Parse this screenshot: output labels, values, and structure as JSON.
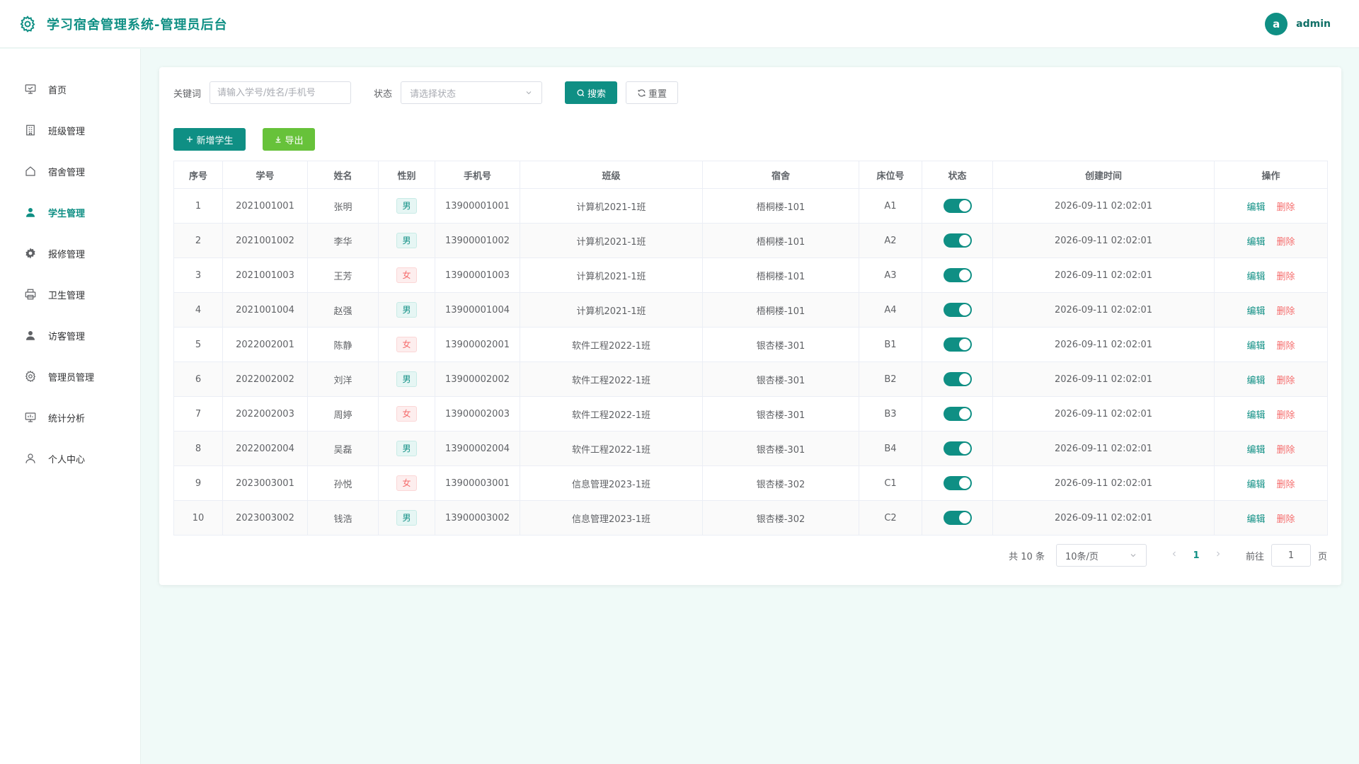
{
  "app": {
    "title": "学习宿舍管理系统-管理员后台"
  },
  "user": {
    "avatar_letter": "a",
    "name": "admin"
  },
  "sidebar": {
    "items": [
      {
        "label": "首页",
        "icon": "home-board-icon"
      },
      {
        "label": "班级管理",
        "icon": "building-icon"
      },
      {
        "label": "宿舍管理",
        "icon": "house-icon"
      },
      {
        "label": "学生管理",
        "icon": "user-icon",
        "active": true
      },
      {
        "label": "报修管理",
        "icon": "gear-icon"
      },
      {
        "label": "卫生管理",
        "icon": "printer-icon"
      },
      {
        "label": "访客管理",
        "icon": "user-icon"
      },
      {
        "label": "管理员管理",
        "icon": "gear-outline-icon"
      },
      {
        "label": "统计分析",
        "icon": "board-icon"
      },
      {
        "label": "个人中心",
        "icon": "user-outline-icon"
      }
    ]
  },
  "filters": {
    "keyword_label": "关键词",
    "keyword_placeholder": "请输入学号/姓名/手机号",
    "status_label": "状态",
    "status_placeholder": "请选择状态",
    "search_label": "搜索",
    "reset_label": "重置"
  },
  "toolbar": {
    "add_label": "新增学生",
    "export_label": "导出"
  },
  "table": {
    "columns": [
      "序号",
      "学号",
      "姓名",
      "性别",
      "手机号",
      "班级",
      "宿舍",
      "床位号",
      "状态",
      "创建时间",
      "操作"
    ],
    "edit_label": "编辑",
    "delete_label": "删除",
    "rows": [
      {
        "no": "1",
        "sid": "2021001001",
        "name": "张明",
        "gender": "男",
        "phone": "13900001001",
        "class": "计算机2021-1班",
        "dorm": "梧桐楼-101",
        "bed": "A1",
        "enabled": true,
        "created": "2026-09-11 02:02:01"
      },
      {
        "no": "2",
        "sid": "2021001002",
        "name": "李华",
        "gender": "男",
        "phone": "13900001002",
        "class": "计算机2021-1班",
        "dorm": "梧桐楼-101",
        "bed": "A2",
        "enabled": true,
        "created": "2026-09-11 02:02:01"
      },
      {
        "no": "3",
        "sid": "2021001003",
        "name": "王芳",
        "gender": "女",
        "phone": "13900001003",
        "class": "计算机2021-1班",
        "dorm": "梧桐楼-101",
        "bed": "A3",
        "enabled": true,
        "created": "2026-09-11 02:02:01"
      },
      {
        "no": "4",
        "sid": "2021001004",
        "name": "赵强",
        "gender": "男",
        "phone": "13900001004",
        "class": "计算机2021-1班",
        "dorm": "梧桐楼-101",
        "bed": "A4",
        "enabled": true,
        "created": "2026-09-11 02:02:01"
      },
      {
        "no": "5",
        "sid": "2022002001",
        "name": "陈静",
        "gender": "女",
        "phone": "13900002001",
        "class": "软件工程2022-1班",
        "dorm": "银杏楼-301",
        "bed": "B1",
        "enabled": true,
        "created": "2026-09-11 02:02:01"
      },
      {
        "no": "6",
        "sid": "2022002002",
        "name": "刘洋",
        "gender": "男",
        "phone": "13900002002",
        "class": "软件工程2022-1班",
        "dorm": "银杏楼-301",
        "bed": "B2",
        "enabled": true,
        "created": "2026-09-11 02:02:01"
      },
      {
        "no": "7",
        "sid": "2022002003",
        "name": "周婷",
        "gender": "女",
        "phone": "13900002003",
        "class": "软件工程2022-1班",
        "dorm": "银杏楼-301",
        "bed": "B3",
        "enabled": true,
        "created": "2026-09-11 02:02:01"
      },
      {
        "no": "8",
        "sid": "2022002004",
        "name": "吴磊",
        "gender": "男",
        "phone": "13900002004",
        "class": "软件工程2022-1班",
        "dorm": "银杏楼-301",
        "bed": "B4",
        "enabled": true,
        "created": "2026-09-11 02:02:01"
      },
      {
        "no": "9",
        "sid": "2023003001",
        "name": "孙悦",
        "gender": "女",
        "phone": "13900003001",
        "class": "信息管理2023-1班",
        "dorm": "银杏楼-302",
        "bed": "C1",
        "enabled": true,
        "created": "2026-09-11 02:02:01"
      },
      {
        "no": "10",
        "sid": "2023003002",
        "name": "钱浩",
        "gender": "男",
        "phone": "13900003002",
        "class": "信息管理2023-1班",
        "dorm": "银杏楼-302",
        "bed": "C2",
        "enabled": true,
        "created": "2026-09-11 02:02:01"
      }
    ]
  },
  "pagination": {
    "total_text": "共 10 条",
    "page_size": "10条/页",
    "current_page": "1",
    "goto_label": "前往",
    "goto_value": "1",
    "page_unit": "页"
  },
  "colors": {
    "primary": "#0f8f84",
    "success": "#67c23a",
    "danger": "#f56c6c"
  }
}
